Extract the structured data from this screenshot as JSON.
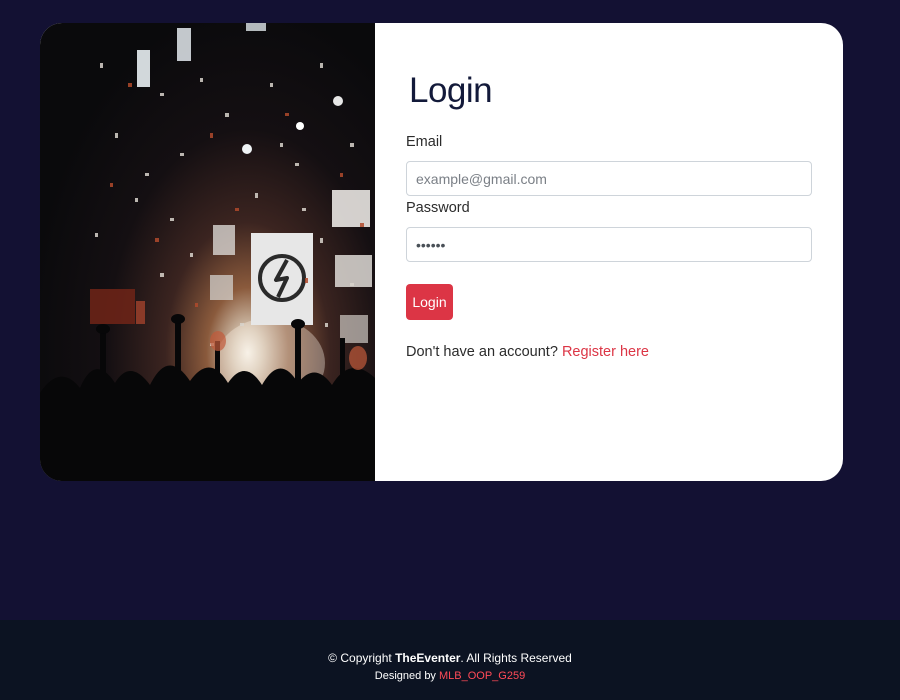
{
  "login": {
    "title": "Login",
    "email_label": "Email",
    "email_placeholder": "example@gmail.com",
    "password_label": "Password",
    "password_value": "******",
    "submit_label": "Login",
    "register_prompt": "Don't have an account?",
    "register_link": "Register here"
  },
  "footer": {
    "copyright_prefix": "© Copyright",
    "brand": "TheEventer",
    "rights": ". All Rights Reserved",
    "designed_by": "Designed by",
    "designer": "MLB_OOP_G259"
  },
  "colors": {
    "page_background": "#131133",
    "accent": "#dc3545",
    "footer_background": "#0c1322"
  },
  "hero_image": {
    "description": "concert-stage-with-confetti"
  }
}
